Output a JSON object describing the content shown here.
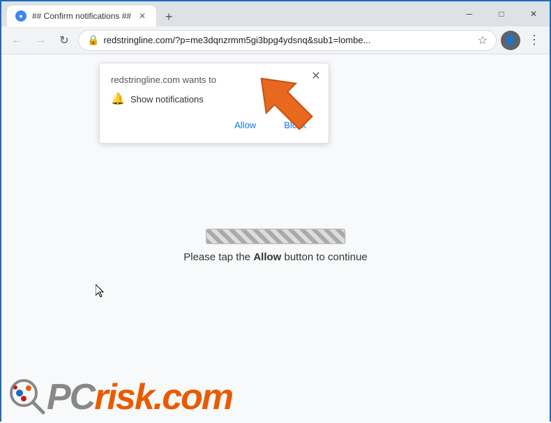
{
  "titlebar": {
    "tab_title": "## Confirm notifications ##",
    "new_tab_label": "+",
    "minimize_label": "─",
    "maximize_label": "□",
    "close_label": "✕"
  },
  "addressbar": {
    "back_icon": "←",
    "forward_icon": "→",
    "reload_icon": "↻",
    "url": "redstringline.com/?p=me3dqnzrmm5gi3bpg4ydsnq&sub1=lombe...",
    "star_icon": "☆",
    "menu_icon": "⋮"
  },
  "notification_popup": {
    "title": "redstringline.com wants to",
    "row_text": "Show notifications",
    "allow_label": "Allow",
    "block_label": "Block",
    "close_icon": "✕"
  },
  "page": {
    "tap_text_before": "Please tap the ",
    "tap_allow": "Allow",
    "tap_text_after": " button to continue"
  },
  "pcrisk": {
    "text_pc": "PC",
    "text_risk": "risk",
    "domain": ".com"
  }
}
